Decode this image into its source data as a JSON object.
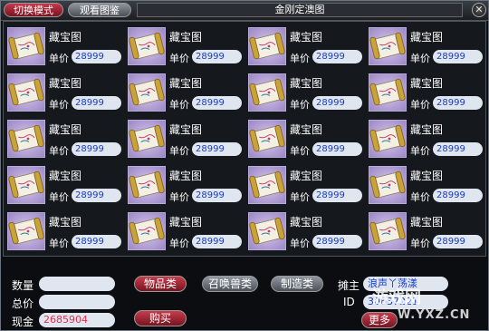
{
  "titlebar": {
    "switch_mode": "切换模式",
    "view_catalog": "观看图鉴",
    "title": "金刚定澳图",
    "close": "✕"
  },
  "items": [
    {
      "name": "藏宝图",
      "price_label": "单价",
      "price": "28999"
    },
    {
      "name": "藏宝图",
      "price_label": "单价",
      "price": "28999"
    },
    {
      "name": "藏宝图",
      "price_label": "单价",
      "price": "28999"
    },
    {
      "name": "藏宝图",
      "price_label": "单价",
      "price": "28999"
    },
    {
      "name": "藏宝图",
      "price_label": "单价",
      "price": "28999"
    },
    {
      "name": "藏宝图",
      "price_label": "单价",
      "price": "28999"
    },
    {
      "name": "藏宝图",
      "price_label": "单价",
      "price": "28999"
    },
    {
      "name": "藏宝图",
      "price_label": "单价",
      "price": "28999"
    },
    {
      "name": "藏宝图",
      "price_label": "单价",
      "price": "28999"
    },
    {
      "name": "藏宝图",
      "price_label": "单价",
      "price": "28999"
    },
    {
      "name": "藏宝图",
      "price_label": "单价",
      "price": "28999"
    },
    {
      "name": "藏宝图",
      "price_label": "单价",
      "price": "28999"
    },
    {
      "name": "藏宝图",
      "price_label": "单价",
      "price": "28999"
    },
    {
      "name": "藏宝图",
      "price_label": "单价",
      "price": "28999"
    },
    {
      "name": "藏宝图",
      "price_label": "单价",
      "price": "28999"
    },
    {
      "name": "藏宝图",
      "price_label": "单价",
      "price": "28999"
    },
    {
      "name": "藏宝图",
      "price_label": "单价",
      "price": "28999"
    },
    {
      "name": "藏宝图",
      "price_label": "单价",
      "price": "28999"
    },
    {
      "name": "藏宝图",
      "price_label": "单价",
      "price": "28999"
    },
    {
      "name": "藏宝图",
      "price_label": "单价",
      "price": "28999"
    }
  ],
  "item_icon": "treasure-map-scroll-icon",
  "bottom": {
    "quantity_label": "数量",
    "quantity_value": "",
    "total_label": "总价",
    "total_value": "",
    "cash_label": "现金",
    "cash_value": "2685904",
    "cat_goods": "物品类",
    "cat_summon": "召唤兽类",
    "cat_craft": "制造类",
    "buy": "购买",
    "owner_label": "摊主",
    "owner_value": "浪声丫荡漾",
    "id_label": "ID",
    "id_value": "30637221",
    "update": "更多"
  },
  "watermark": {
    "logo": "游戏网",
    "url": "W.YXZ.CN"
  },
  "colors": {
    "price_text": "#1a3cbc",
    "cash_text": "#e0304a",
    "red_button": "#a22434",
    "gray_button": "#6d7179"
  }
}
